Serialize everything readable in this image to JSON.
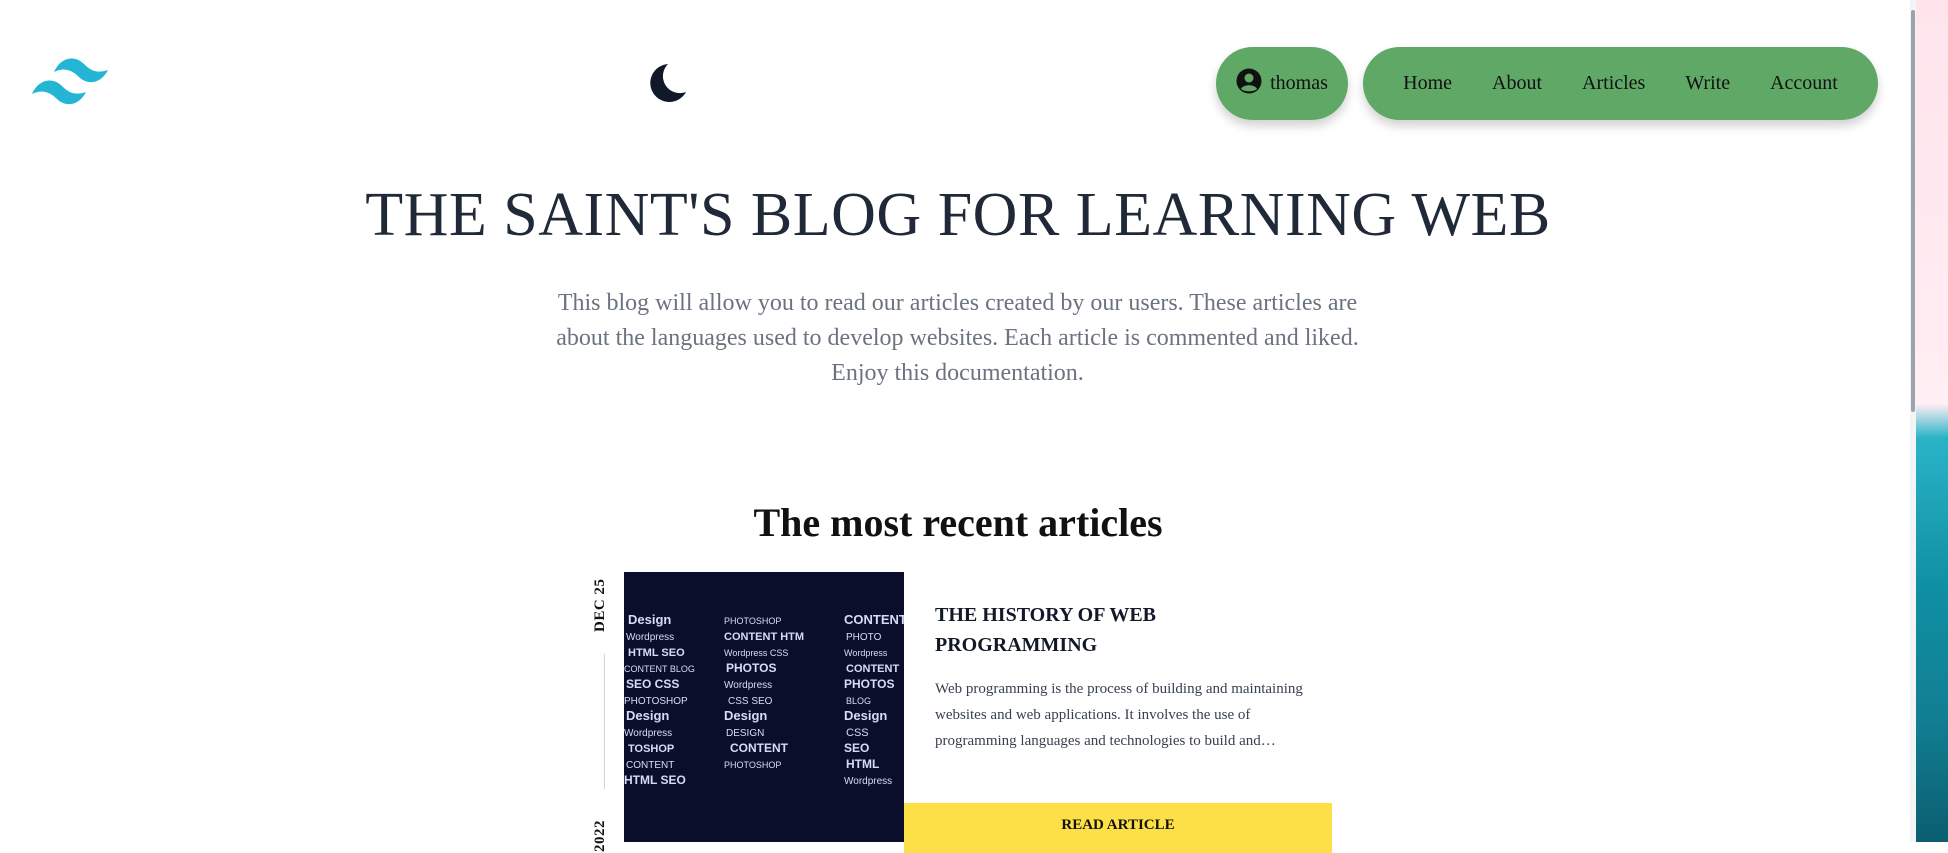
{
  "header": {
    "logo_icon": "tailwind-waves-icon",
    "theme_toggle_icon": "moon-icon",
    "user": {
      "icon": "user-circle-icon",
      "name": "thomas"
    },
    "nav": [
      {
        "label": "Home"
      },
      {
        "label": "About"
      },
      {
        "label": "Articles"
      },
      {
        "label": "Write"
      },
      {
        "label": "Account"
      }
    ],
    "accent_color": "#5fa866"
  },
  "hero": {
    "title": "THE SAINT'S BLOG FOR LEARNING WEB",
    "description": "This blog will allow you to read our articles created by our users. These articles are about the languages used to develop websites. Each article is commented and liked. Enjoy this documentation."
  },
  "recent": {
    "heading": "The most recent articles",
    "articles": [
      {
        "date_day": "DEC 25",
        "date_year": "2022",
        "title": "THE HISTORY OF WEB PROGRAMMING",
        "excerpt": "Web programming is the process of building and maintaining websites and web applications. It involves the use of programming languages and technologies to build and maintain websites.",
        "button_label": "READ ARTICLE",
        "button_color": "#fde047"
      }
    ]
  }
}
